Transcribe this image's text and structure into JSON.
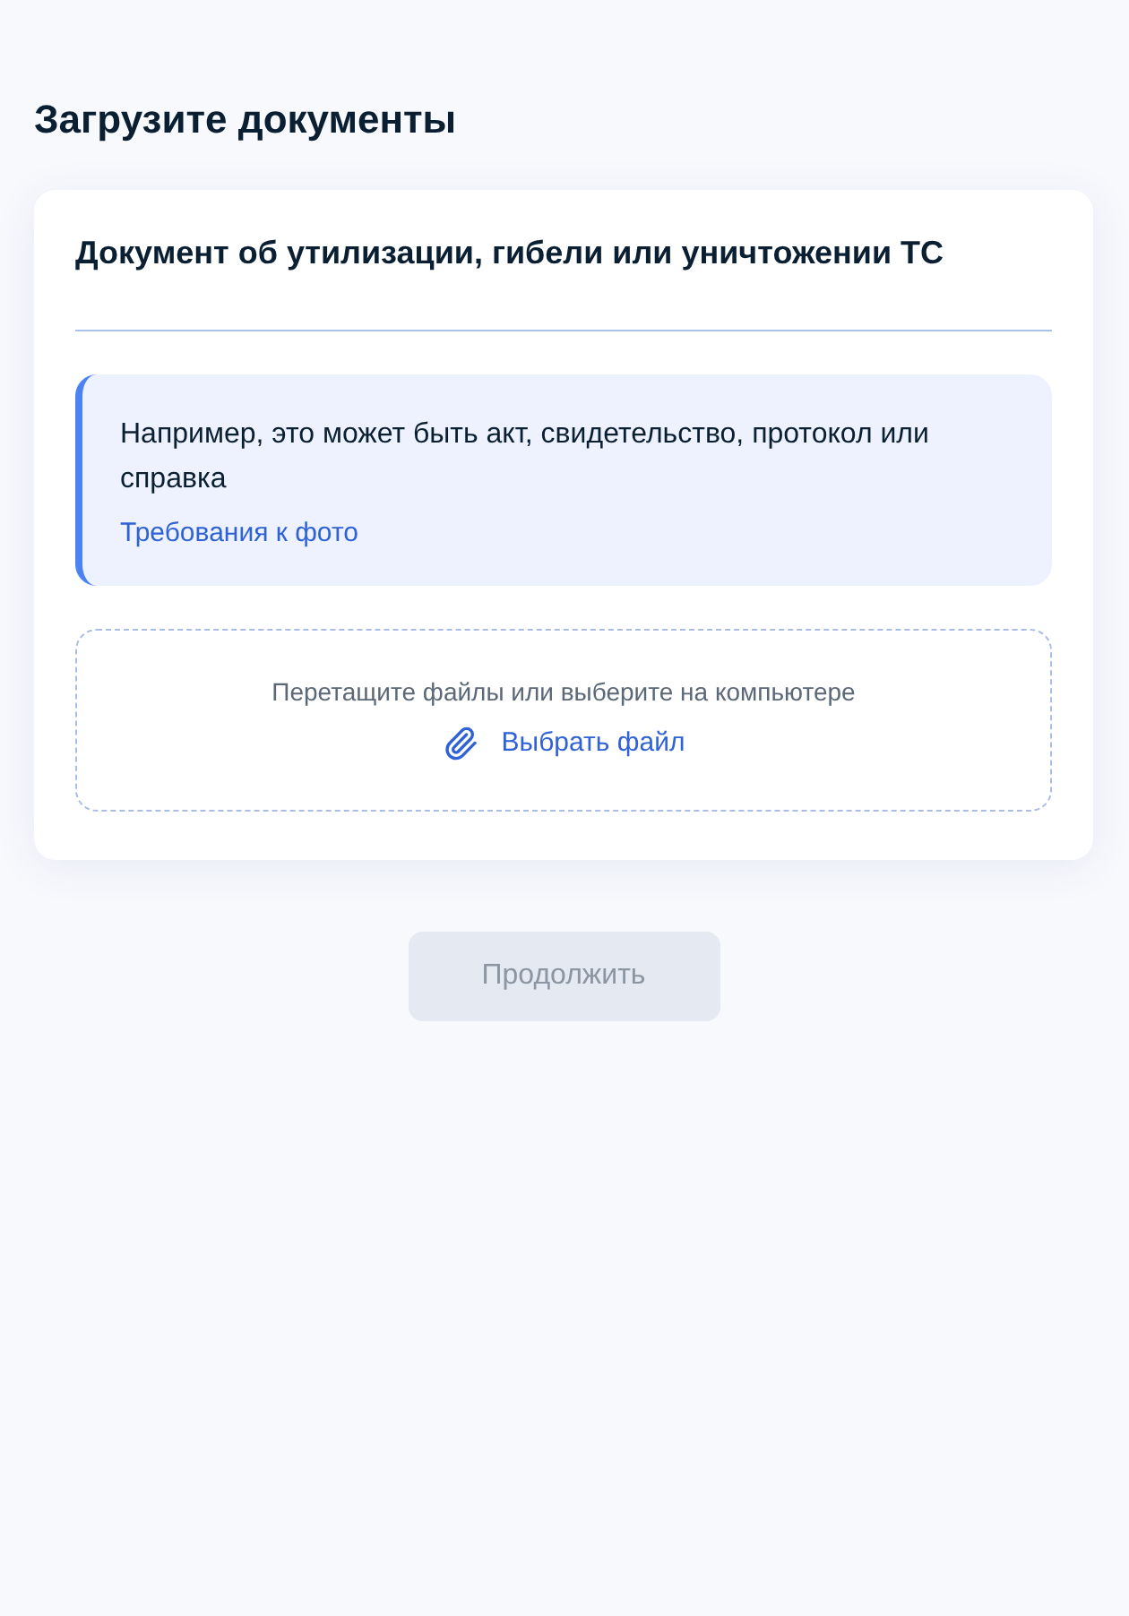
{
  "page_title": "Загрузите документы",
  "card": {
    "title": "Документ об утилизации, гибели или уничтожении ТС",
    "hint": {
      "text": "Например, это может быть акт, свидетельство, протокол или справка",
      "link": "Требования к фото"
    },
    "dropzone": {
      "instruction": "Перетащите файлы или выберите на компьютере",
      "choose_button": "Выбрать файл"
    }
  },
  "continue_button": {
    "label": "Продолжить",
    "disabled": true
  }
}
